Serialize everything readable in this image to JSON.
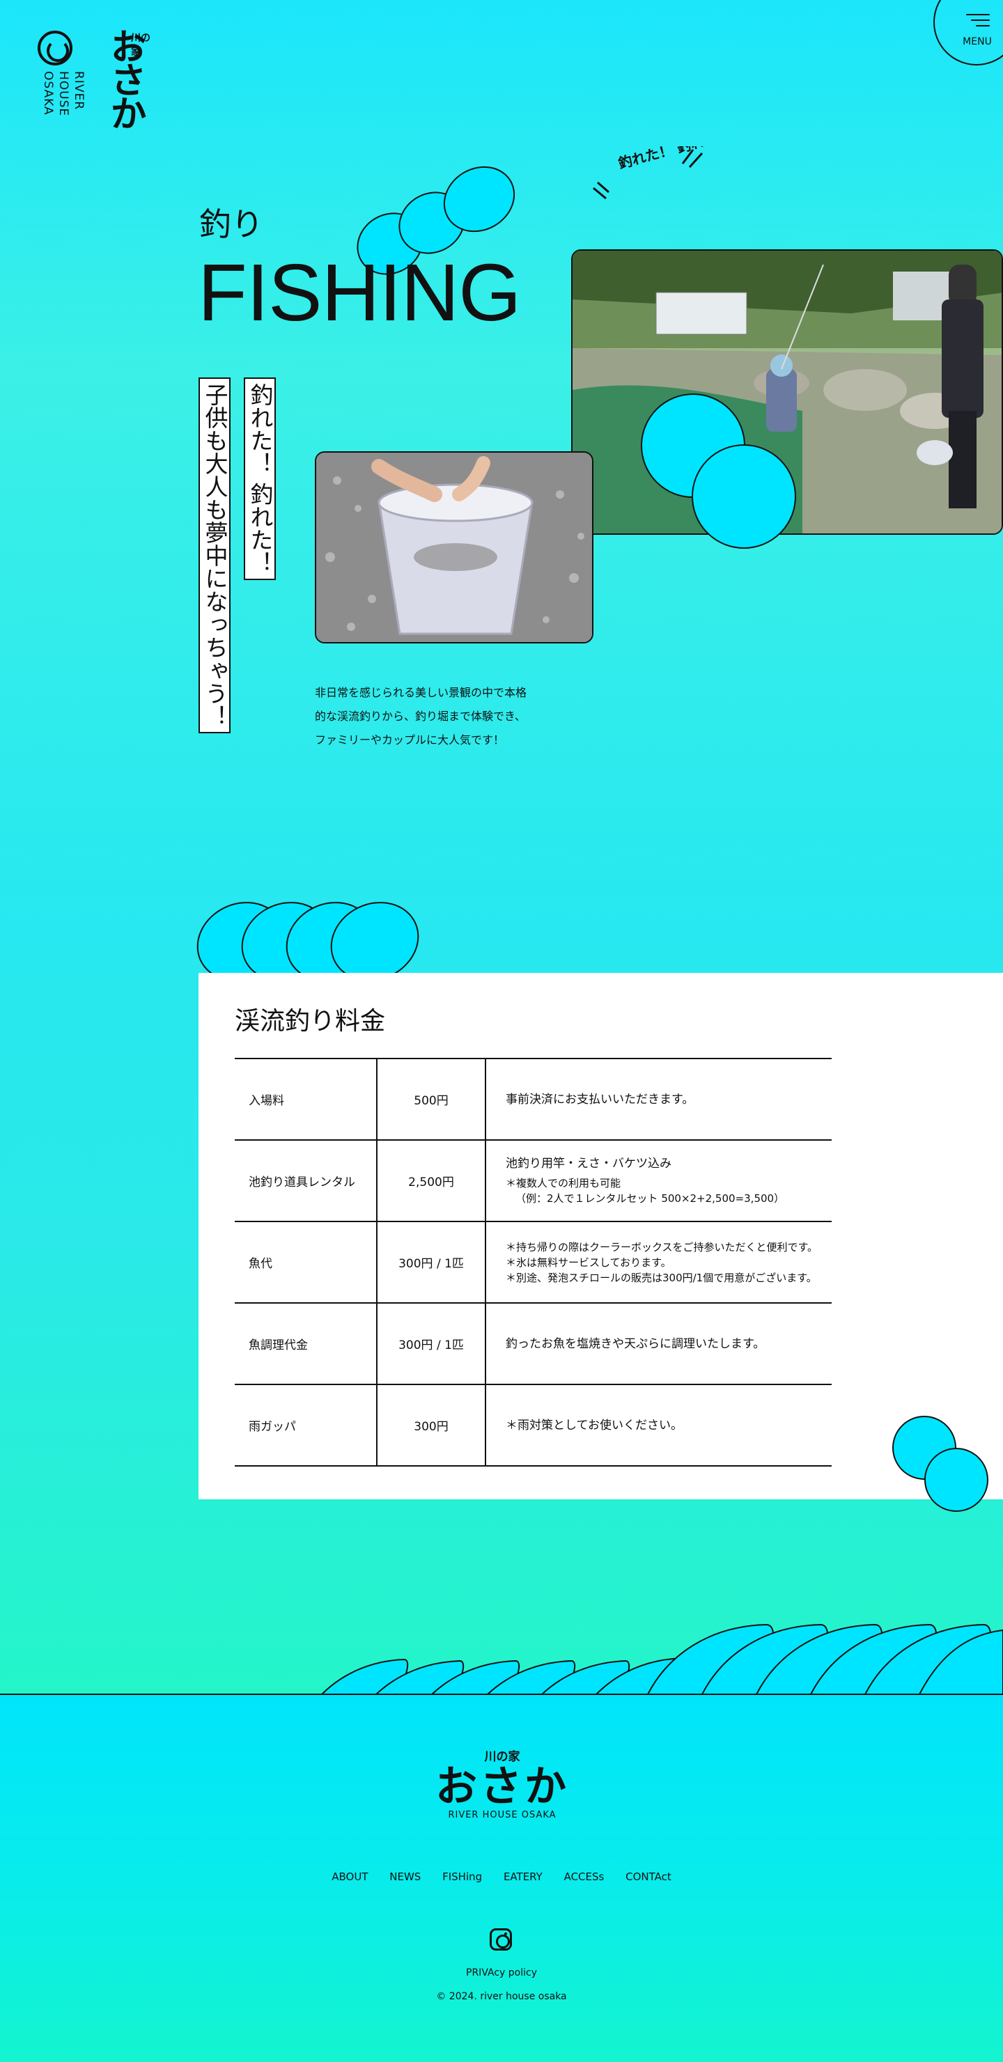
{
  "colors": {
    "accent": "#00e5ff",
    "ink": "#111111",
    "panel": "#ffffff"
  },
  "header": {
    "logo_small": "川の家",
    "logo_main": "おさか",
    "logo_en": "RIVER HOUSE OSAKA",
    "menu_label": "MENU"
  },
  "hero": {
    "title_jp": "釣り",
    "title_en": "FISHING",
    "catch_vertical_1": "子供も大人も夢中になっちゃう！",
    "catch_vertical_2": "釣れた！ 釣れた！",
    "handwritten": "釣れた！ 釣れた！",
    "description_lines": [
      "非日常を感じられる美しい景観の中で本格",
      "的な渓流釣りから、釣り堀まで体験でき、",
      "ファミリーやカップルに大人気です！"
    ]
  },
  "price": {
    "title": "渓流釣り料金",
    "rows": [
      {
        "item": "入場料",
        "price": "500円",
        "main": "事前決済にお支払いいただきます。",
        "notes": []
      },
      {
        "item": "池釣り道具レンタル",
        "price": "2,500円",
        "main": "池釣り用竿・えさ・バケツ込み",
        "notes": [
          "＊複数人での利用も可能",
          "（例：2人で１レンタルセット 500×2+2,500=3,500）"
        ]
      },
      {
        "item": "魚代",
        "price": "300円 / 1匹",
        "main": "",
        "notes": [
          "＊持ち帰りの際はクーラーボックスをご持参いただくと便利です。",
          "＊氷は無料サービスしております。",
          "＊別途、発泡スチロールの販売は300円/1個で用意がございます。"
        ]
      },
      {
        "item": "魚調理代金",
        "price": "300円 / 1匹",
        "main": "釣ったお魚を塩焼きや天ぷらに調理いたします。",
        "notes": []
      },
      {
        "item": "雨ガッパ",
        "price": "300円",
        "main": "＊雨対策としてお使いください。",
        "notes": []
      }
    ]
  },
  "footer": {
    "logo_small": "川の家",
    "logo_main": "おさか",
    "logo_en": "RIVER HOUSE OSAKA",
    "nav": [
      "ABOUT",
      "NEWS",
      "FISHing",
      "EATERY",
      "ACCESs",
      "CONTAct"
    ],
    "instagram_icon": "instagram-icon",
    "privacy": "PRIVAcy policy",
    "copyright": "© 2024. river house osaka"
  }
}
